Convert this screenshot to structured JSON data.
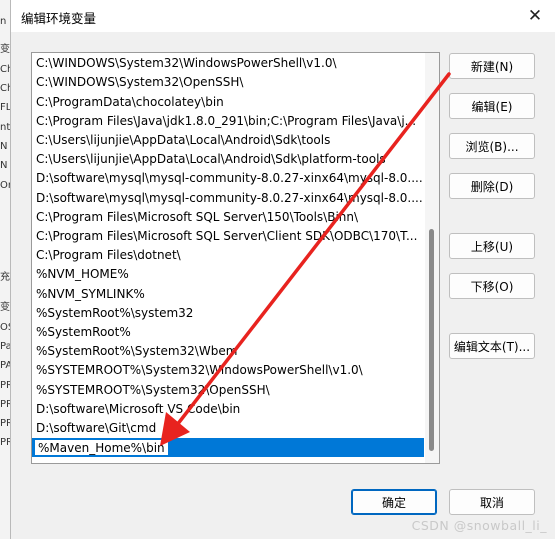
{
  "background_window": {
    "strip_text": [
      "n",
      "变",
      "Ch",
      "Ch",
      "FL",
      "nt",
      "N",
      "N",
      "Or",
      "充",
      "变",
      "OS",
      "Pa",
      "PA",
      "PR",
      "PR",
      "PR",
      "PR"
    ]
  },
  "dialog": {
    "title": "编辑环境变量",
    "close_icon": "close-icon"
  },
  "path_list": {
    "entries": [
      "C:\\WINDOWS\\System32\\WindowsPowerShell\\v1.0\\",
      "C:\\WINDOWS\\System32\\OpenSSH\\",
      "C:\\ProgramData\\chocolatey\\bin",
      "C:\\Program Files\\Java\\jdk1.8.0_291\\bin;C:\\Program Files\\Java\\j...",
      "C:\\Users\\lijunjie\\AppData\\Local\\Android\\Sdk\\tools",
      "C:\\Users\\lijunjie\\AppData\\Local\\Android\\Sdk\\platform-tools",
      "D:\\software\\mysql\\mysql-community-8.0.27-xinx64\\mysql-8.0....",
      "D:\\software\\mysql\\mysql-community-8.0.27-xinx64\\mysql-8.0....",
      "C:\\Program Files\\Microsoft SQL Server\\150\\Tools\\Binn\\",
      "C:\\Program Files\\Microsoft SQL Server\\Client SDK\\ODBC\\170\\T...",
      "C:\\Program Files\\dotnet\\",
      "%NVM_HOME%",
      "%NVM_SYMLINK%",
      "%SystemRoot%\\system32",
      "%SystemRoot%",
      "%SystemRoot%\\System32\\Wbem",
      "%SYSTEMROOT%\\System32\\WindowsPowerShell\\v1.0\\",
      "%SYSTEMROOT%\\System32\\OpenSSH\\",
      "D:\\software\\Microsoft VS Code\\bin",
      "D:\\software\\Git\\cmd"
    ],
    "editing_value": "%Maven_Home%\\bin"
  },
  "buttons": {
    "new": "新建(N)",
    "edit": "编辑(E)",
    "browse": "浏览(B)...",
    "delete": "删除(D)",
    "move_up": "上移(U)",
    "move_down": "下移(O)",
    "edit_text": "编辑文本(T)...",
    "ok": "确定",
    "cancel": "取消"
  },
  "watermark": "CSDN @snowball_li_",
  "colors": {
    "selection": "#0078d7",
    "annotation_arrow": "#e8231f"
  }
}
